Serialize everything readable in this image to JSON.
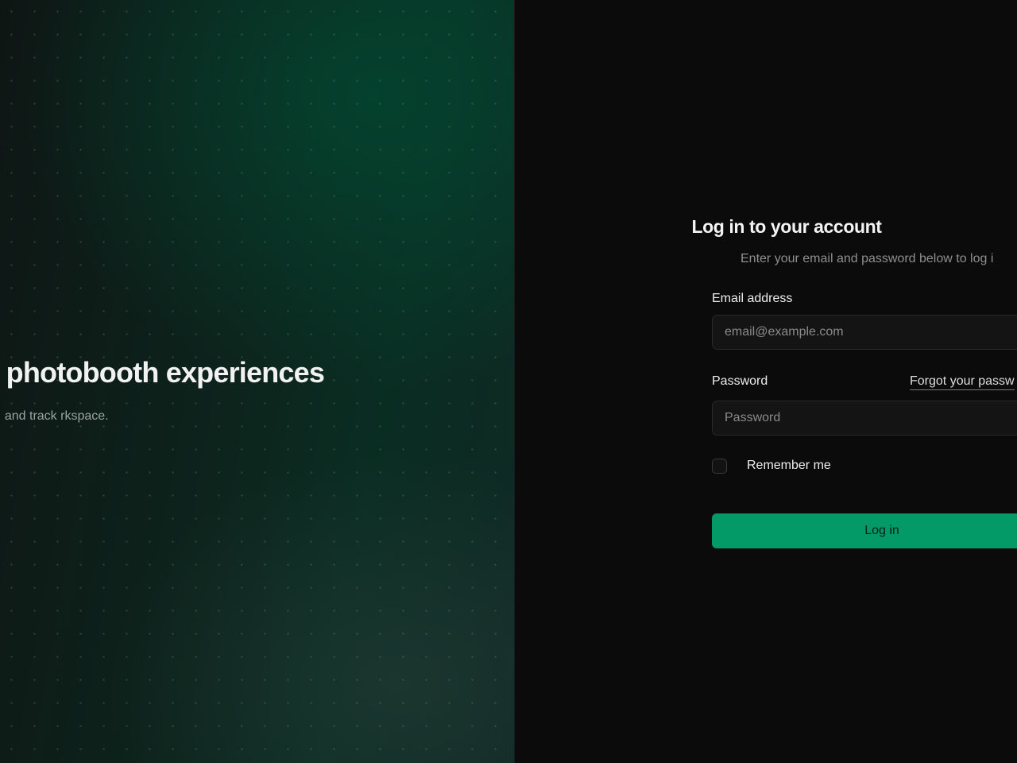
{
  "hero": {
    "title": "ettable photobooth experiences",
    "subtitle": "anage your themes, and track rkspace."
  },
  "login": {
    "title": "Log in to your account",
    "subtitle": "Enter your email and password below to log i",
    "email": {
      "label": "Email address",
      "placeholder": "email@example.com",
      "value": ""
    },
    "password": {
      "label": "Password",
      "placeholder": "Password",
      "value": "",
      "forgot_link": "Forgot your passw"
    },
    "remember": {
      "label": "Remember me",
      "checked": false
    },
    "submit_label": "Log in"
  },
  "colors": {
    "accent": "#039a68",
    "panel_background": "#0b0b0b",
    "hero_green": "#034630"
  }
}
